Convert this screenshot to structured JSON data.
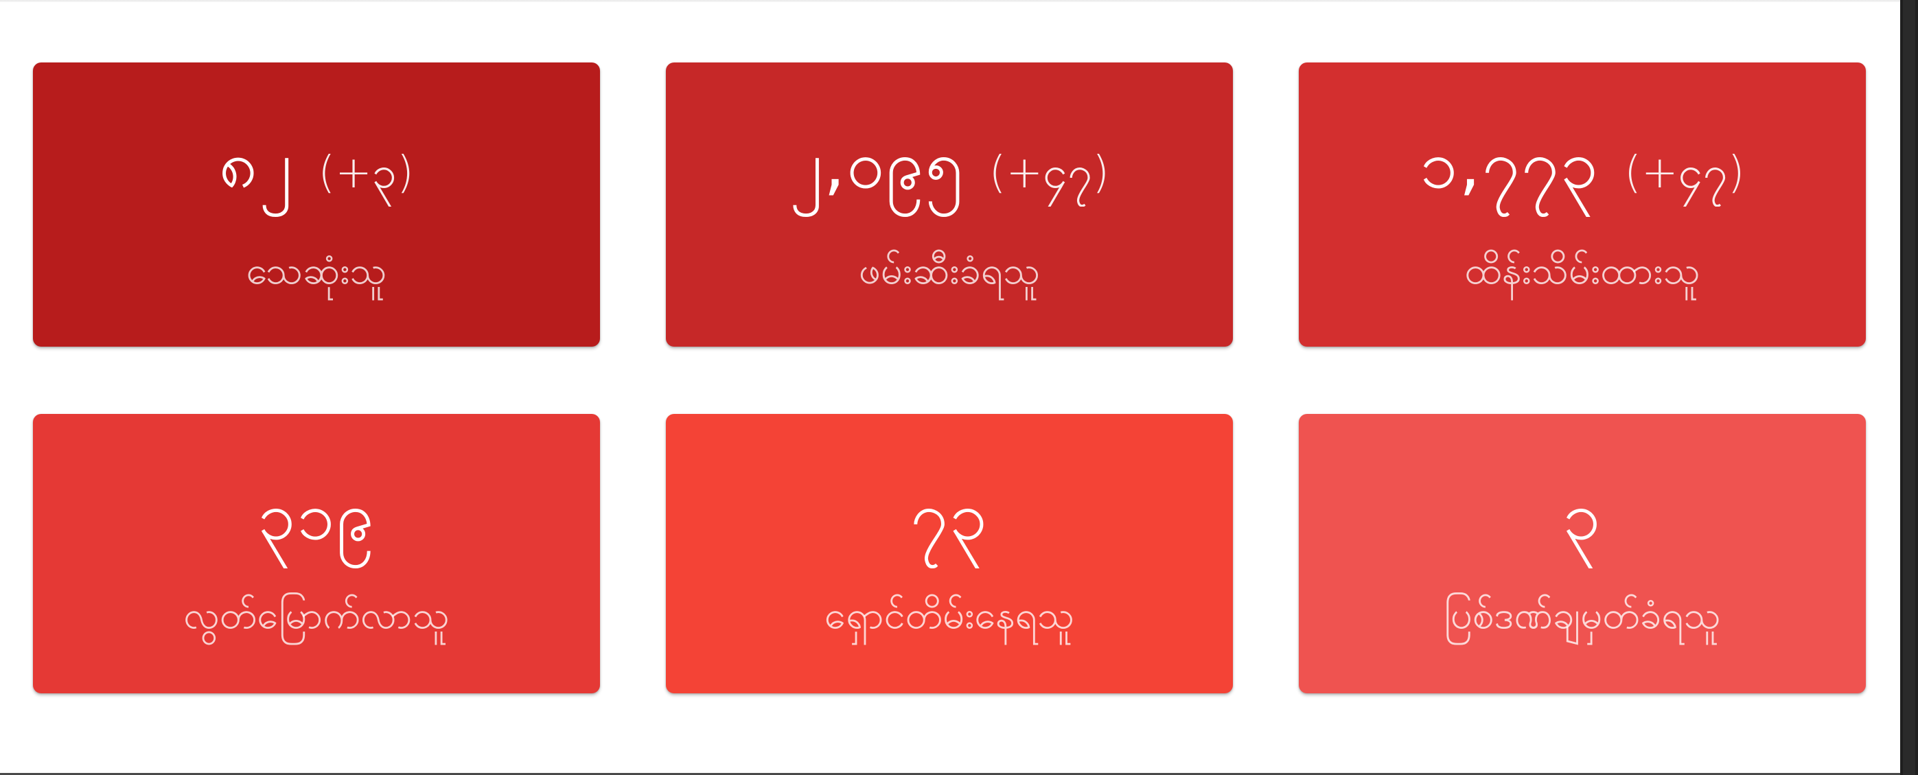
{
  "cards": [
    {
      "value": "၈၂",
      "delta": "(+၃)",
      "label": "သေဆုံးသူ",
      "color": "#b71c1c"
    },
    {
      "value": "၂,၀၉၅",
      "delta": "(+၄၇)",
      "label": "ဖမ်းဆီးခံရသူ",
      "color": "#c62828"
    },
    {
      "value": "၁,၇၇၃",
      "delta": "(+၄၇)",
      "label": "ထိန်းသိမ်းထားသူ",
      "color": "#d32f2f"
    },
    {
      "value": "၃၁၉",
      "delta": "",
      "label": "လွတ်မြောက်လာသူ",
      "color": "#e53935"
    },
    {
      "value": "၇၃",
      "delta": "",
      "label": "ရှောင်တိမ်းနေရသူ",
      "color": "#f44336"
    },
    {
      "value": "၃",
      "delta": "",
      "label": "ပြစ်ဒဏ်ချမှတ်ခံရသူ",
      "color": "#ef5350"
    }
  ]
}
